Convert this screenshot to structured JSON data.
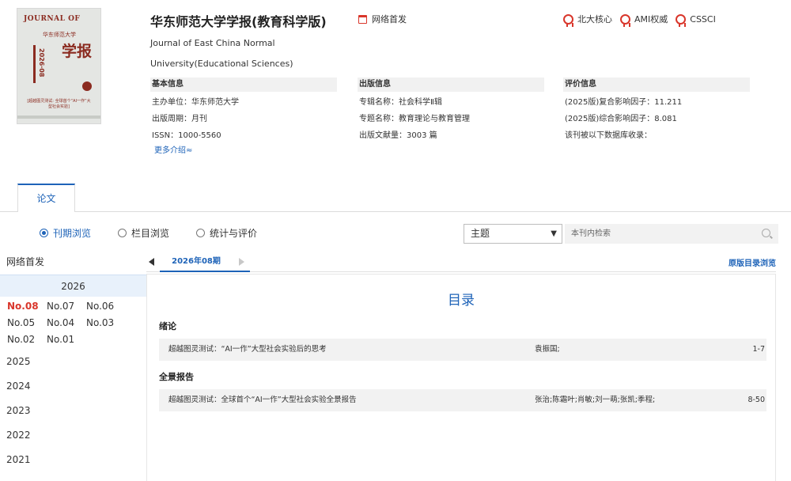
{
  "journal": {
    "title": "华东师范大学学报(教育科学版)",
    "english_title": "Journal of East China Normal University(Educational Sciences)",
    "first_publish_label": "网络首发",
    "badges": [
      "北大核心",
      "AMI权威",
      "CSSCI"
    ]
  },
  "cover": {
    "top_text": "JOURNAL OF",
    "school": "华东师范大学",
    "big_text": "学报",
    "issue": "2026·08",
    "note": "[超越图灵测试: 全球首个“AI一作”大型社会实验]"
  },
  "info": {
    "basic": {
      "heading": "基本信息",
      "sponsor": "主办单位：华东师范大学",
      "cycle": "出版周期：月刊",
      "issn": "ISSN：1000-5560",
      "more": "更多介绍≈"
    },
    "publish": {
      "heading": "出版信息",
      "series": "专辑名称：社会科学Ⅱ辑",
      "topic": "专题名称：教育理论与教育管理",
      "volume": "出版文献量：3003 篇"
    },
    "evaluation": {
      "heading": "评价信息",
      "composite_if": "(2025版)复合影响因子：11.211",
      "comprehensive_if": "(2025版)综合影响因子：8.081",
      "databases": "该刊被以下数据库收录："
    }
  },
  "tabs": {
    "papers": "论文"
  },
  "browse": {
    "options": [
      "刊期浏览",
      "栏目浏览",
      "统计与评价"
    ],
    "selected_index": 0
  },
  "search": {
    "field_value": "主题",
    "placeholder": "本刊内检索"
  },
  "left_nav": {
    "title": "网络首发",
    "current_year": "2026",
    "issues": [
      "No.08",
      "No.07",
      "No.06",
      "No.05",
      "No.04",
      "No.03",
      "No.02",
      "No.01"
    ],
    "active_issue": "No.08",
    "years": [
      "2025",
      "2024",
      "2023",
      "2022",
      "2021"
    ]
  },
  "main": {
    "current_issue": "2026年08期",
    "original_toc": "原版目录浏览",
    "toc_title": "目录",
    "sections": [
      {
        "name": "绪论",
        "articles": [
          {
            "title": "超越图灵测试：“AI一作”大型社会实验后的思考",
            "authors": "袁振国;",
            "pages": "1-7"
          }
        ]
      },
      {
        "name": "全景报告",
        "articles": [
          {
            "title": "超越图灵测试：全球首个“AI一作”大型社会实验全景报告",
            "authors": "张治;陈霜叶;肖敏;刘一萌;张凯;季程;",
            "pages": "8-50"
          }
        ]
      }
    ]
  },
  "colors": {
    "accent_blue": "#1e63b8",
    "active_red": "#d9362b"
  }
}
